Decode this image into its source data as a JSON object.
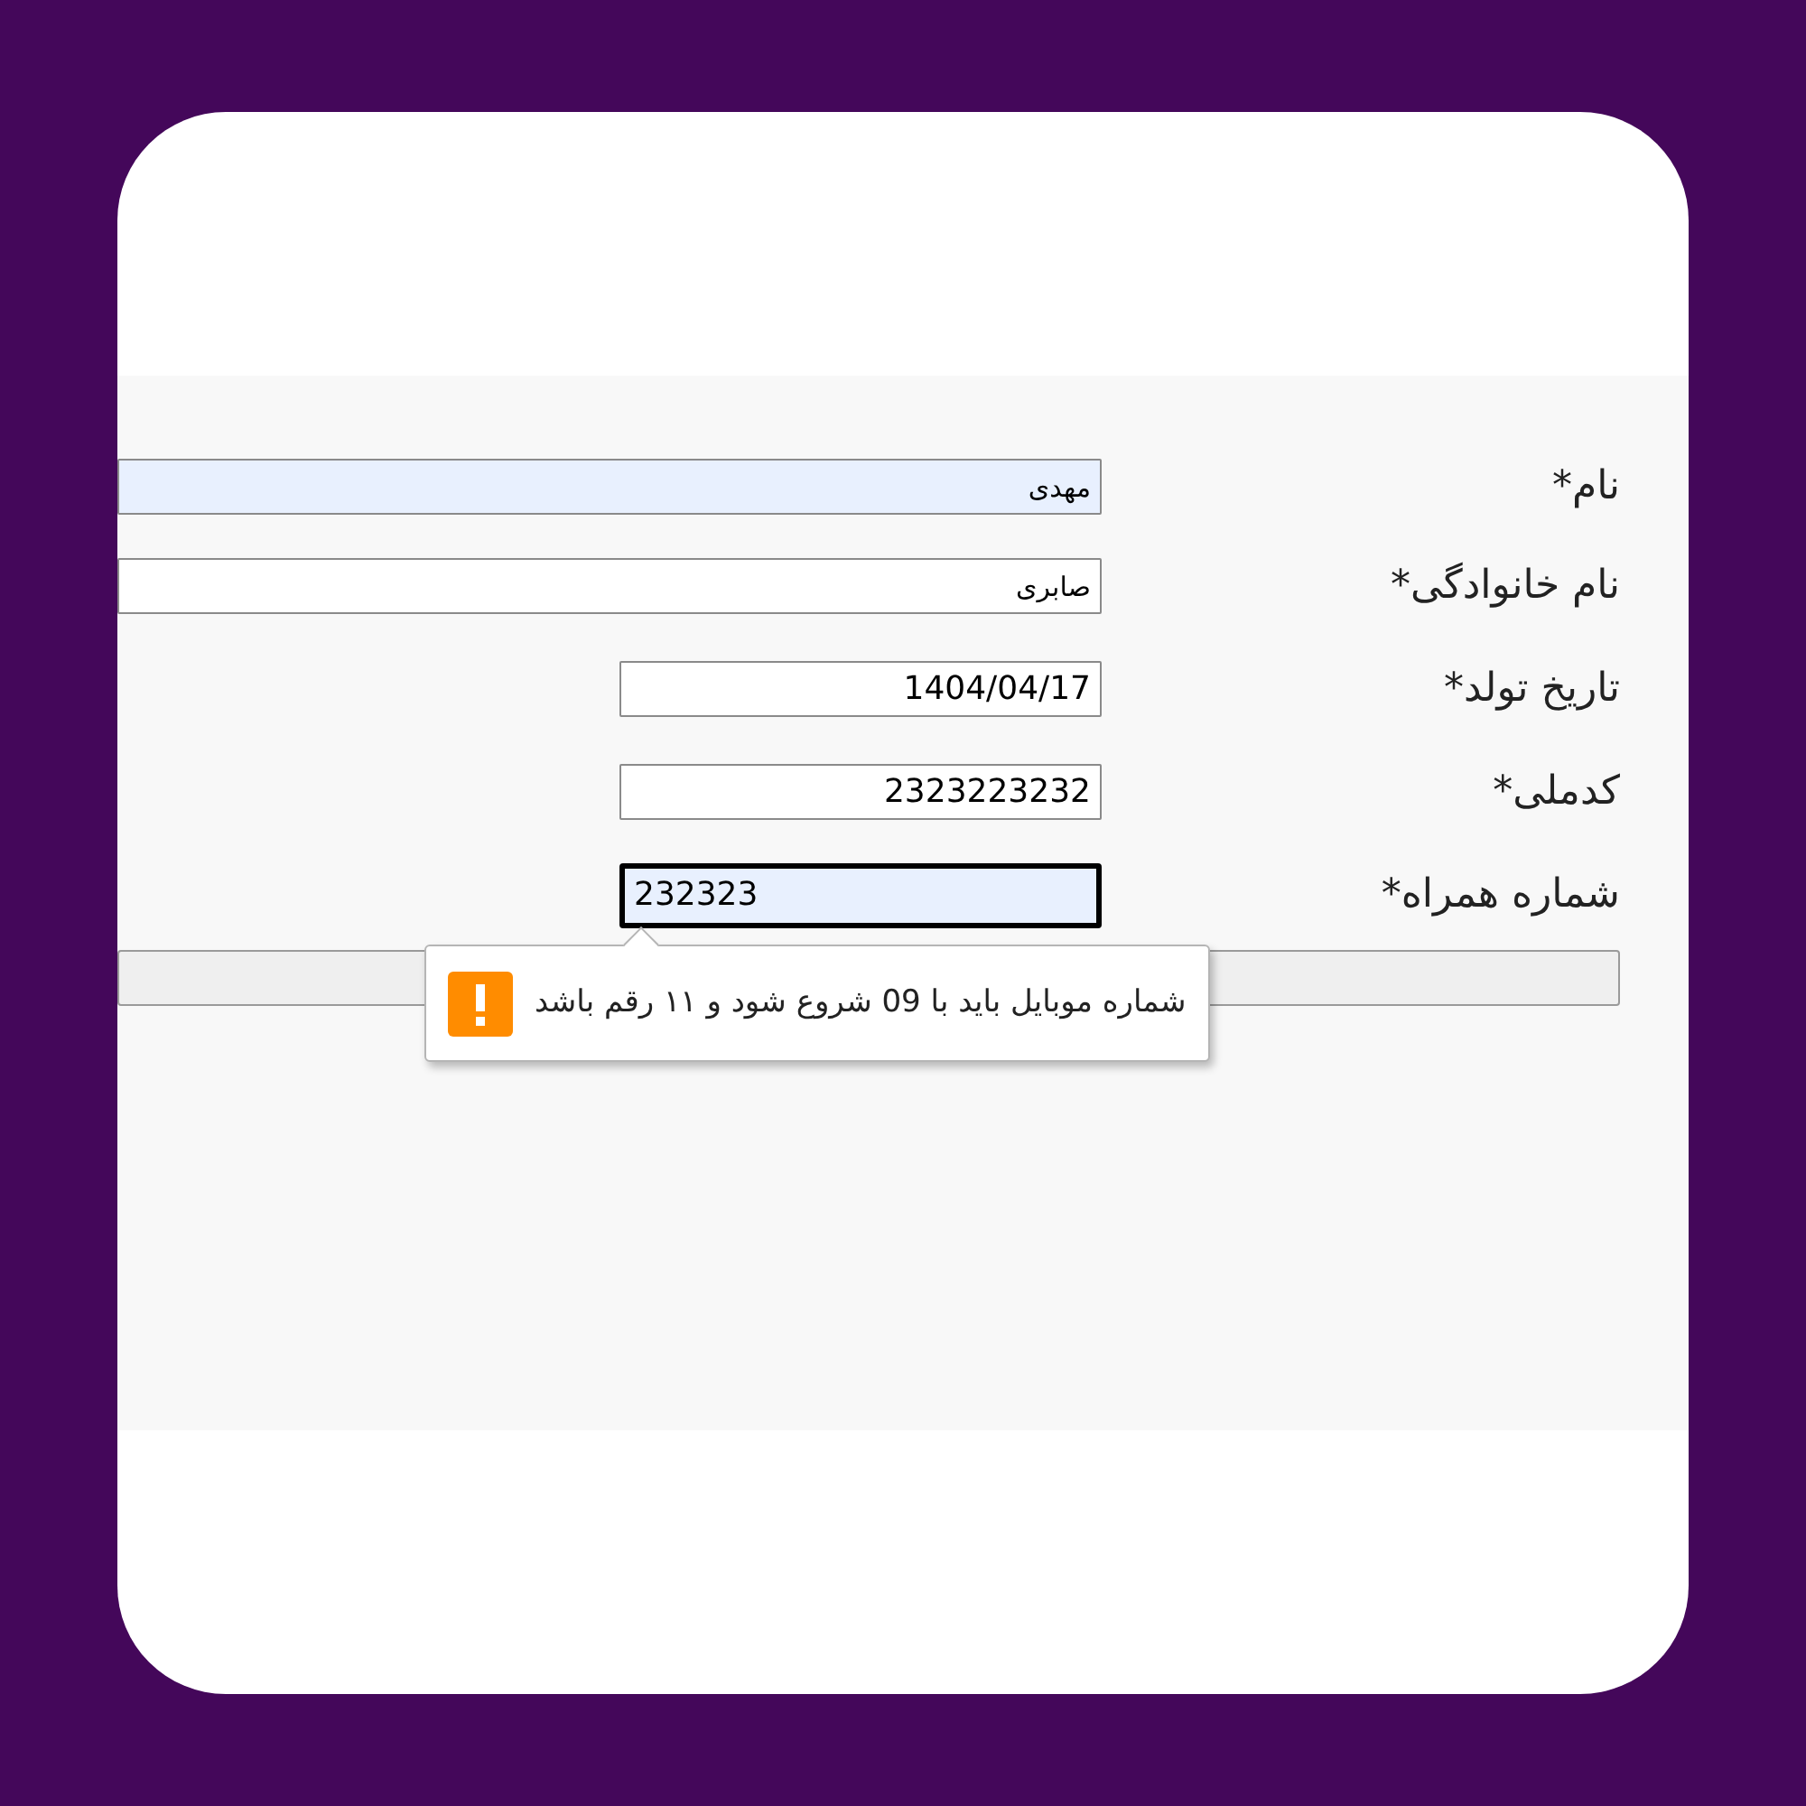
{
  "form": {
    "fields": [
      {
        "label": "نام*",
        "value": "مهدی",
        "kind": "wide",
        "ltr": false,
        "autofilled": true,
        "focused": false
      },
      {
        "label": "نام خانوادگی*",
        "value": "صابری",
        "kind": "wide",
        "ltr": false,
        "autofilled": false,
        "focused": false
      },
      {
        "label": "تاریخ تولد*",
        "value": "1404/04/17",
        "kind": "short",
        "ltr": false,
        "autofilled": false,
        "focused": false
      },
      {
        "label": "کدملی*",
        "value": "2323223232",
        "kind": "short",
        "ltr": false,
        "autofilled": false,
        "focused": false
      },
      {
        "label": "شماره همراه*",
        "value": "232323",
        "kind": "short",
        "ltr": true,
        "autofilled": true,
        "focused": true
      }
    ]
  },
  "validation_tooltip": {
    "message": "شماره موبایل باید با 09 شروع شود و ۱۱ رقم باشد"
  }
}
